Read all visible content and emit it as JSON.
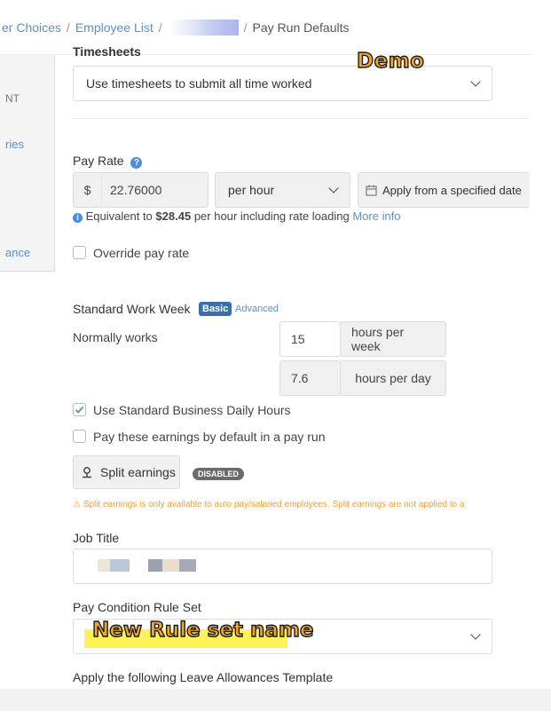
{
  "breadcrumb": {
    "item1": "er Choices",
    "item2": "Employee List",
    "current": "Pay Run Defaults",
    "separator": "/"
  },
  "sidebar": {
    "item1": "NT",
    "item2": "ries",
    "item3": "ance"
  },
  "timesheets": {
    "label": "Timesheets",
    "value": "Use timesheets to submit all time worked"
  },
  "demo_overlay": "Demo",
  "pay_rate": {
    "label": "Pay Rate",
    "currency": "$",
    "amount": "22.76000",
    "unit": "per hour",
    "apply_button": "Apply from a specified date",
    "equivalent_prefix": "Equivalent to",
    "equivalent_amount": "$28.45",
    "equivalent_suffix": "per hour including rate loading",
    "more_info": "More info"
  },
  "override": {
    "label": "Override pay rate"
  },
  "work_week": {
    "label": "Standard Work Week",
    "basic": "Basic",
    "advanced": "Advanced",
    "normally_works": "Normally works",
    "hours_per_week_value": "15",
    "hours_per_week_label": "hours per week",
    "hours_per_day_value": "7.6",
    "hours_per_day_label": "hours per day"
  },
  "options": {
    "standard_hours": "Use Standard Business Daily Hours",
    "default_earnings": "Pay these earnings by default in a pay run"
  },
  "split": {
    "button": "Split earnings",
    "badge": "DISABLED",
    "warning": "Split earnings is only available to auto pay/salaried employees. Split earnings are not applied to a"
  },
  "job_title": {
    "label": "Job Title"
  },
  "pay_condition": {
    "label": "Pay Condition Rule Set",
    "overlay": "New Rule set name"
  },
  "leave_template": {
    "label": "Apply the following Leave Allowances Template"
  },
  "colors": {
    "accent": "#5b8fd0",
    "badge_blue": "#3a6fa8",
    "badge_grey": "#6b6b6b",
    "warning": "#f0a030",
    "overlay_orange": "#f5a623",
    "highlight_yellow": "#fff15a"
  }
}
